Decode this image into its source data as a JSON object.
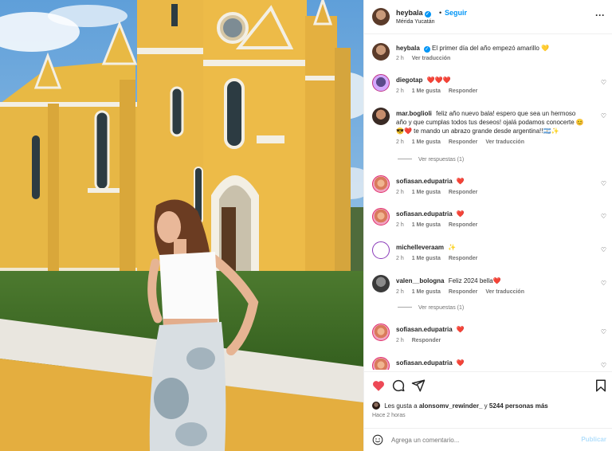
{
  "post_author": {
    "username": "heybala",
    "verified_icon": "verified-badge-icon",
    "separator": "•",
    "follow_label": "Seguir",
    "location": "Mérida Yucatán",
    "more_icon": "more-options-icon"
  },
  "caption": {
    "username": "heybala",
    "text": "El primer día del año empezó amarillo 💛",
    "time": "2 h",
    "translate": "Ver traducción"
  },
  "comments": [
    {
      "username": "diegotap",
      "text": "❤️❤️❤️",
      "time": "2 h",
      "likes": "1 Me gusta",
      "reply": "Responder"
    },
    {
      "username": "mar.boglioli",
      "text": "feliz año nuevo bala! espero que sea un hermoso año y que cumplas todos tus deseos! ojalá podamos conocerte 😊😎❤️ te mando un abrazo grande desde argentina!!🇦🇷✨",
      "time": "2 h",
      "likes": "1 Me gusta",
      "reply": "Responder",
      "translate": "Ver traducción",
      "replies": "Ver respuestas (1)"
    },
    {
      "username": "sofiasan.edupatria",
      "text": "❤️",
      "time": "2 h",
      "likes": "1 Me gusta",
      "reply": "Responder"
    },
    {
      "username": "sofiasan.edupatria",
      "text": "❤️",
      "time": "2 h",
      "likes": "1 Me gusta",
      "reply": "Responder"
    },
    {
      "username": "michelleveraam",
      "text": "✨",
      "time": "2 h",
      "likes": "1 Me gusta",
      "reply": "Responder"
    },
    {
      "username": "valen__bologna",
      "text": "Feliz 2024 bella❤️",
      "time": "2 h",
      "likes": "1 Me gusta",
      "reply": "Responder",
      "translate": "Ver traducción",
      "replies": "Ver respuestas (1)"
    },
    {
      "username": "sofiasan.edupatria",
      "text": "❤️",
      "time": "2 h",
      "reply": "Responder"
    },
    {
      "username": "sofiasan.edupatria",
      "text": "❤️",
      "time": "",
      "reply": ""
    }
  ],
  "actions": {
    "like_icon": "heart-filled-icon",
    "comment_icon": "comment-icon",
    "share_icon": "share-icon",
    "save_icon": "bookmark-icon",
    "like_color": "#ed4956"
  },
  "likes": {
    "prefix": "Les gusta a",
    "first_user": "alonsomv_rewinder_",
    "middle": "y",
    "others": "5244 personas más"
  },
  "time_ago": "Hace 2 horas",
  "add_comment": {
    "emoji_icon": "emoji-icon",
    "placeholder": "Agrega un comentario...",
    "publish_label": "Publicar"
  }
}
